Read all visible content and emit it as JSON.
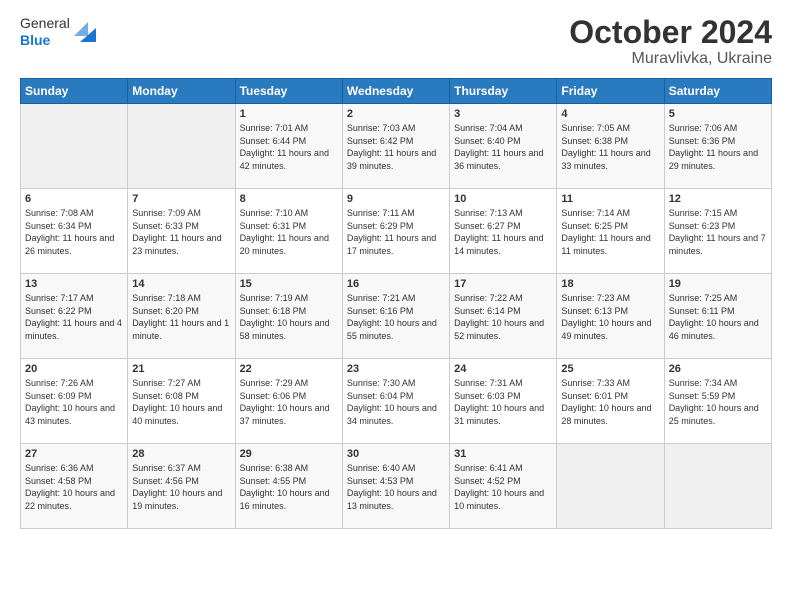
{
  "logo": {
    "line1": "General",
    "line2": "Blue"
  },
  "title": "October 2024",
  "subtitle": "Muravlivka, Ukraine",
  "days_of_week": [
    "Sunday",
    "Monday",
    "Tuesday",
    "Wednesday",
    "Thursday",
    "Friday",
    "Saturday"
  ],
  "weeks": [
    [
      {
        "day": "",
        "sunrise": "",
        "sunset": "",
        "daylight": ""
      },
      {
        "day": "",
        "sunrise": "",
        "sunset": "",
        "daylight": ""
      },
      {
        "day": "1",
        "sunrise": "Sunrise: 7:01 AM",
        "sunset": "Sunset: 6:44 PM",
        "daylight": "Daylight: 11 hours and 42 minutes."
      },
      {
        "day": "2",
        "sunrise": "Sunrise: 7:03 AM",
        "sunset": "Sunset: 6:42 PM",
        "daylight": "Daylight: 11 hours and 39 minutes."
      },
      {
        "day": "3",
        "sunrise": "Sunrise: 7:04 AM",
        "sunset": "Sunset: 6:40 PM",
        "daylight": "Daylight: 11 hours and 36 minutes."
      },
      {
        "day": "4",
        "sunrise": "Sunrise: 7:05 AM",
        "sunset": "Sunset: 6:38 PM",
        "daylight": "Daylight: 11 hours and 33 minutes."
      },
      {
        "day": "5",
        "sunrise": "Sunrise: 7:06 AM",
        "sunset": "Sunset: 6:36 PM",
        "daylight": "Daylight: 11 hours and 29 minutes."
      }
    ],
    [
      {
        "day": "6",
        "sunrise": "Sunrise: 7:08 AM",
        "sunset": "Sunset: 6:34 PM",
        "daylight": "Daylight: 11 hours and 26 minutes."
      },
      {
        "day": "7",
        "sunrise": "Sunrise: 7:09 AM",
        "sunset": "Sunset: 6:33 PM",
        "daylight": "Daylight: 11 hours and 23 minutes."
      },
      {
        "day": "8",
        "sunrise": "Sunrise: 7:10 AM",
        "sunset": "Sunset: 6:31 PM",
        "daylight": "Daylight: 11 hours and 20 minutes."
      },
      {
        "day": "9",
        "sunrise": "Sunrise: 7:11 AM",
        "sunset": "Sunset: 6:29 PM",
        "daylight": "Daylight: 11 hours and 17 minutes."
      },
      {
        "day": "10",
        "sunrise": "Sunrise: 7:13 AM",
        "sunset": "Sunset: 6:27 PM",
        "daylight": "Daylight: 11 hours and 14 minutes."
      },
      {
        "day": "11",
        "sunrise": "Sunrise: 7:14 AM",
        "sunset": "Sunset: 6:25 PM",
        "daylight": "Daylight: 11 hours and 11 minutes."
      },
      {
        "day": "12",
        "sunrise": "Sunrise: 7:15 AM",
        "sunset": "Sunset: 6:23 PM",
        "daylight": "Daylight: 11 hours and 7 minutes."
      }
    ],
    [
      {
        "day": "13",
        "sunrise": "Sunrise: 7:17 AM",
        "sunset": "Sunset: 6:22 PM",
        "daylight": "Daylight: 11 hours and 4 minutes."
      },
      {
        "day": "14",
        "sunrise": "Sunrise: 7:18 AM",
        "sunset": "Sunset: 6:20 PM",
        "daylight": "Daylight: 11 hours and 1 minute."
      },
      {
        "day": "15",
        "sunrise": "Sunrise: 7:19 AM",
        "sunset": "Sunset: 6:18 PM",
        "daylight": "Daylight: 10 hours and 58 minutes."
      },
      {
        "day": "16",
        "sunrise": "Sunrise: 7:21 AM",
        "sunset": "Sunset: 6:16 PM",
        "daylight": "Daylight: 10 hours and 55 minutes."
      },
      {
        "day": "17",
        "sunrise": "Sunrise: 7:22 AM",
        "sunset": "Sunset: 6:14 PM",
        "daylight": "Daylight: 10 hours and 52 minutes."
      },
      {
        "day": "18",
        "sunrise": "Sunrise: 7:23 AM",
        "sunset": "Sunset: 6:13 PM",
        "daylight": "Daylight: 10 hours and 49 minutes."
      },
      {
        "day": "19",
        "sunrise": "Sunrise: 7:25 AM",
        "sunset": "Sunset: 6:11 PM",
        "daylight": "Daylight: 10 hours and 46 minutes."
      }
    ],
    [
      {
        "day": "20",
        "sunrise": "Sunrise: 7:26 AM",
        "sunset": "Sunset: 6:09 PM",
        "daylight": "Daylight: 10 hours and 43 minutes."
      },
      {
        "day": "21",
        "sunrise": "Sunrise: 7:27 AM",
        "sunset": "Sunset: 6:08 PM",
        "daylight": "Daylight: 10 hours and 40 minutes."
      },
      {
        "day": "22",
        "sunrise": "Sunrise: 7:29 AM",
        "sunset": "Sunset: 6:06 PM",
        "daylight": "Daylight: 10 hours and 37 minutes."
      },
      {
        "day": "23",
        "sunrise": "Sunrise: 7:30 AM",
        "sunset": "Sunset: 6:04 PM",
        "daylight": "Daylight: 10 hours and 34 minutes."
      },
      {
        "day": "24",
        "sunrise": "Sunrise: 7:31 AM",
        "sunset": "Sunset: 6:03 PM",
        "daylight": "Daylight: 10 hours and 31 minutes."
      },
      {
        "day": "25",
        "sunrise": "Sunrise: 7:33 AM",
        "sunset": "Sunset: 6:01 PM",
        "daylight": "Daylight: 10 hours and 28 minutes."
      },
      {
        "day": "26",
        "sunrise": "Sunrise: 7:34 AM",
        "sunset": "Sunset: 5:59 PM",
        "daylight": "Daylight: 10 hours and 25 minutes."
      }
    ],
    [
      {
        "day": "27",
        "sunrise": "Sunrise: 6:36 AM",
        "sunset": "Sunset: 4:58 PM",
        "daylight": "Daylight: 10 hours and 22 minutes."
      },
      {
        "day": "28",
        "sunrise": "Sunrise: 6:37 AM",
        "sunset": "Sunset: 4:56 PM",
        "daylight": "Daylight: 10 hours and 19 minutes."
      },
      {
        "day": "29",
        "sunrise": "Sunrise: 6:38 AM",
        "sunset": "Sunset: 4:55 PM",
        "daylight": "Daylight: 10 hours and 16 minutes."
      },
      {
        "day": "30",
        "sunrise": "Sunrise: 6:40 AM",
        "sunset": "Sunset: 4:53 PM",
        "daylight": "Daylight: 10 hours and 13 minutes."
      },
      {
        "day": "31",
        "sunrise": "Sunrise: 6:41 AM",
        "sunset": "Sunset: 4:52 PM",
        "daylight": "Daylight: 10 hours and 10 minutes."
      },
      {
        "day": "",
        "sunrise": "",
        "sunset": "",
        "daylight": ""
      },
      {
        "day": "",
        "sunrise": "",
        "sunset": "",
        "daylight": ""
      }
    ]
  ]
}
